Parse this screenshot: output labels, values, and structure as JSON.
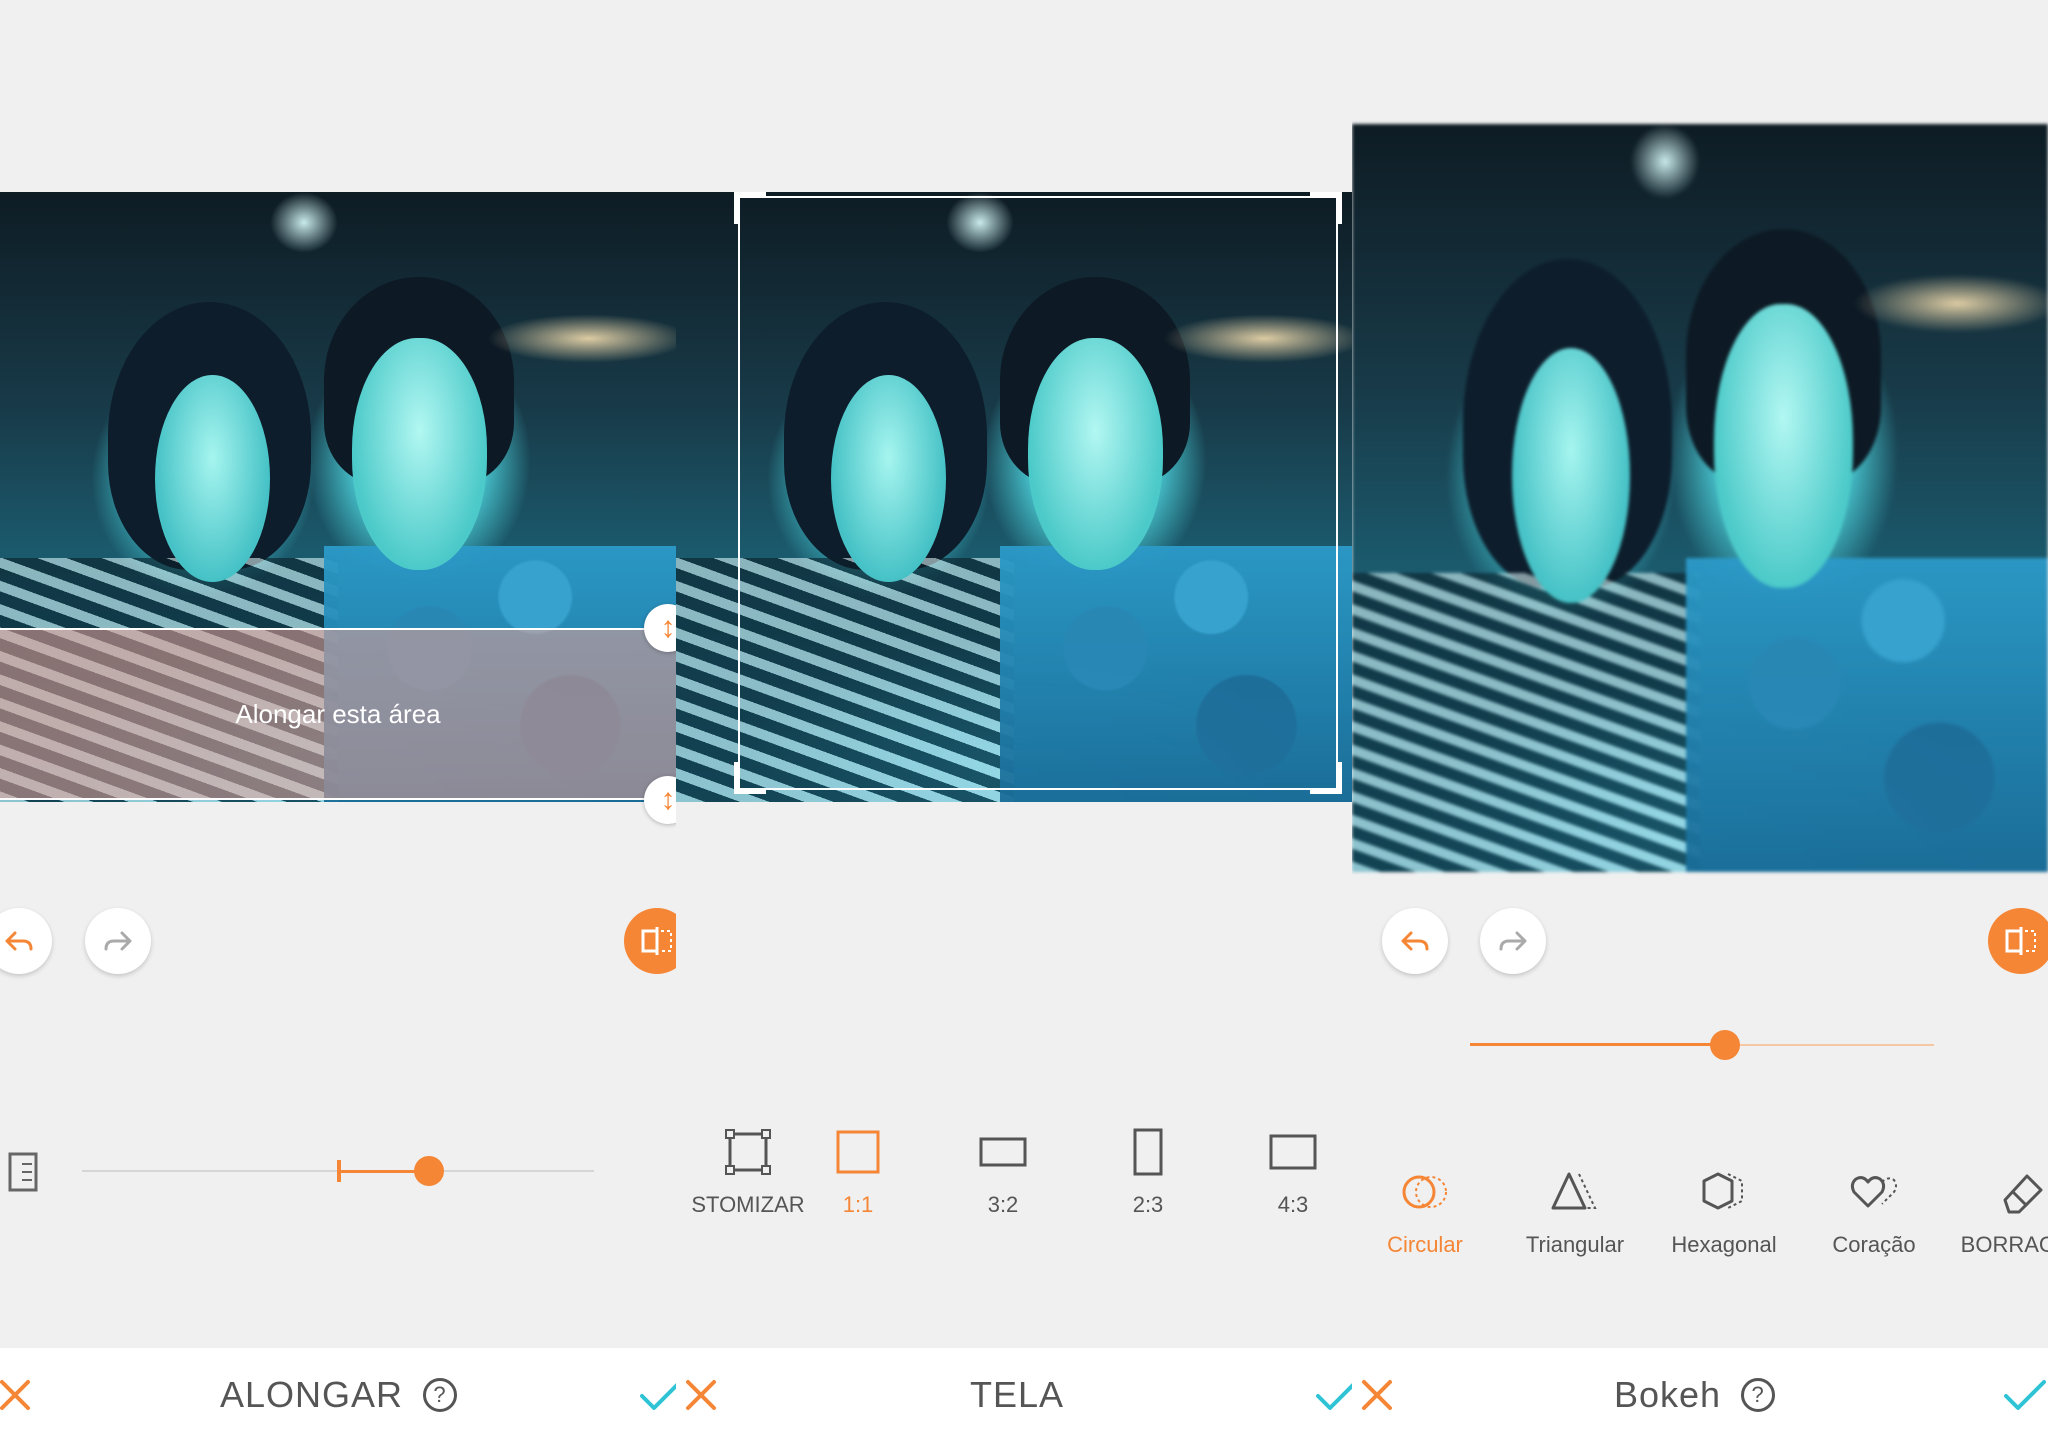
{
  "panels": [
    {
      "title": "ALONGAR",
      "overlay_label": "Alongar esta área",
      "slider_value": 0.68
    },
    {
      "title": "TELA",
      "tools": [
        {
          "label": "STOMIZAR",
          "icon": "custom-crop-icon",
          "active": false
        },
        {
          "label": "1:1",
          "icon": "square-icon",
          "active": true
        },
        {
          "label": "3:2",
          "icon": "landscape-3-2-icon",
          "active": false
        },
        {
          "label": "2:3",
          "icon": "portrait-2-3-icon",
          "active": false
        },
        {
          "label": "4:3",
          "icon": "landscape-4-3-icon",
          "active": false
        }
      ]
    },
    {
      "title": "Bokeh",
      "slider_value": 0.55,
      "tools": [
        {
          "label": "Circular",
          "icon": "circular-bokeh-icon",
          "active": true
        },
        {
          "label": "Triangular",
          "icon": "triangular-bokeh-icon",
          "active": false
        },
        {
          "label": "Hexagonal",
          "icon": "hexagonal-bokeh-icon",
          "active": false
        },
        {
          "label": "Coração",
          "icon": "heart-bokeh-icon",
          "active": false
        },
        {
          "label": "BORRACHA",
          "icon": "eraser-icon",
          "active": false
        }
      ]
    }
  ],
  "colors": {
    "accent": "#f58636",
    "confirm": "#2ec4d6",
    "text": "#555555",
    "background": "#f0f0f0"
  }
}
